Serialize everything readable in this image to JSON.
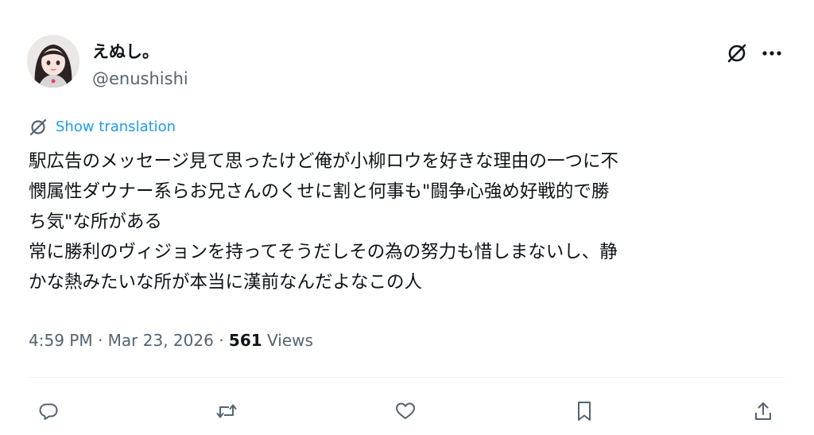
{
  "author": {
    "display_name": "えぬし。",
    "handle": "@enushishi"
  },
  "translate": {
    "label": "Show translation",
    "icon": "translate-icon"
  },
  "tweet": {
    "lines": [
      "駅広告のメッセージ見て思ったけど俺が小柳ロウを好きな理由の一つに不",
      "憫属性ダウナー系らお兄さんのくせに割と何事も\"闘争心強め好戦的で勝",
      "ち気\"な所がある",
      "常に勝利のヴィジョンを持ってそうだしその為の努力も惜しまないし、静",
      "かな熱みたいな所が本当に漢前なんだよなこの人"
    ]
  },
  "meta": {
    "time": "4:59 PM",
    "separator": "·",
    "date": "Mar 23, 2026",
    "views_count": "561",
    "views_label": "Views"
  },
  "actions": {
    "reply": "reply-icon",
    "repost": "repost-icon",
    "like": "like-icon",
    "bookmark": "bookmark-icon",
    "share": "share-icon"
  },
  "colors": {
    "accent": "#1d9bf0",
    "secondary_text": "#536471",
    "primary_text": "#0f1419"
  }
}
